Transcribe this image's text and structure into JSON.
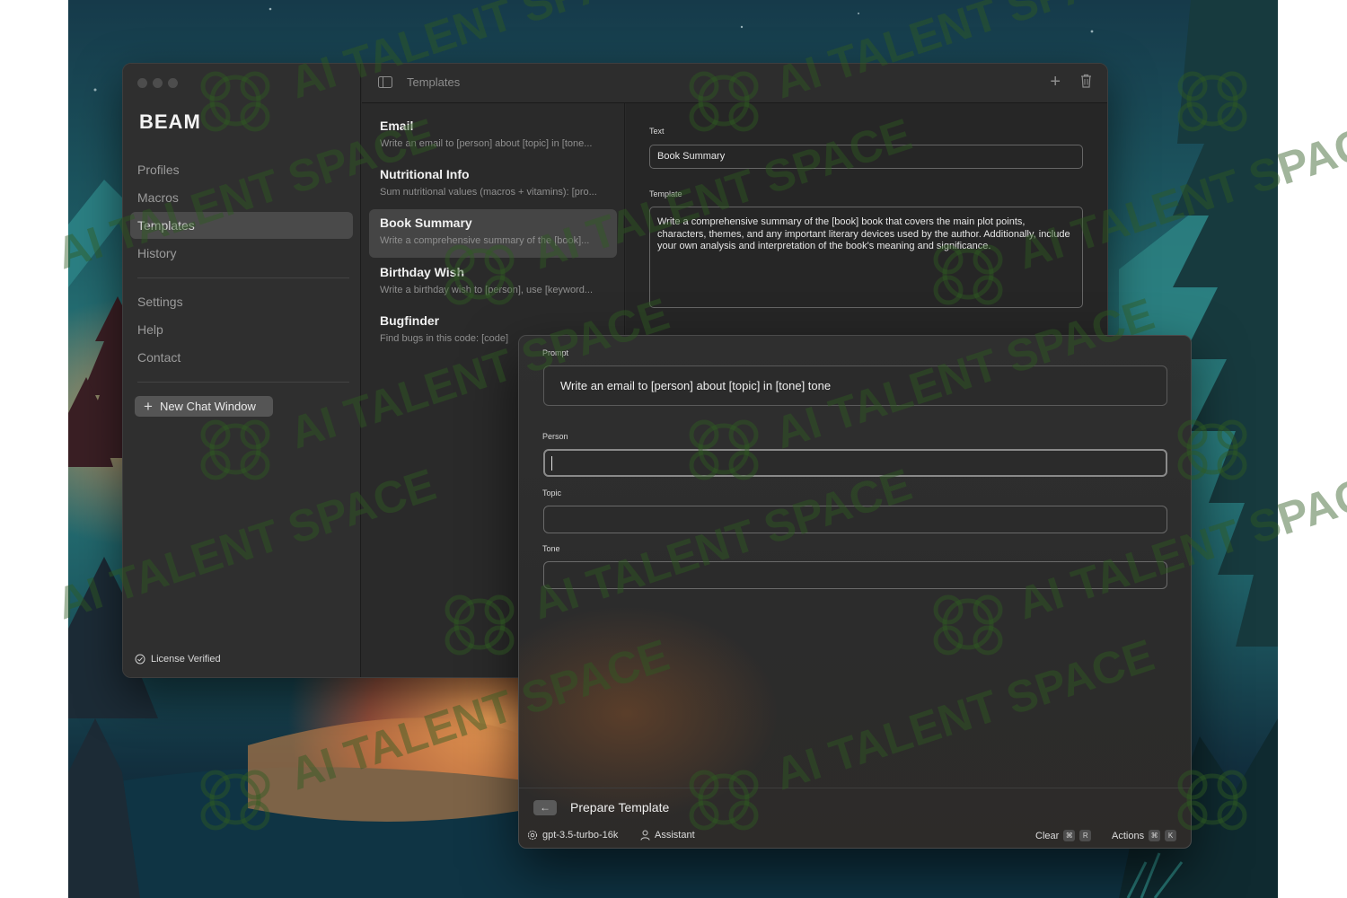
{
  "window": {
    "brand": "BEAM",
    "titlebar_title": "Templates"
  },
  "sidebar": {
    "items": [
      {
        "label": "Profiles"
      },
      {
        "label": "Macros"
      },
      {
        "label": "Templates",
        "active": true
      },
      {
        "label": "History"
      },
      {
        "label": "Settings"
      },
      {
        "label": "Help"
      },
      {
        "label": "Contact"
      }
    ],
    "new_chat_label": "New Chat Window",
    "license_label": "License Verified"
  },
  "templates": [
    {
      "title": "Email",
      "desc": "Write an email to [person] about [topic] in [tone..."
    },
    {
      "title": "Nutritional Info",
      "desc": "Sum nutritional values (macros + vitamins): [pro..."
    },
    {
      "title": "Book Summary",
      "desc": "Write a comprehensive summary of the [book]...",
      "active": true
    },
    {
      "title": "Birthday Wish",
      "desc": "Write a birthday wish to [person], use [keyword..."
    },
    {
      "title": "Bugfinder",
      "desc": "Find bugs in this code: [code]"
    }
  ],
  "detail": {
    "text_label": "Text",
    "text_value": "Book Summary",
    "template_label": "Template",
    "template_value": "Write a comprehensive summary of the [book] book that covers the main plot points, characters, themes, and any important literary devices used by the author. Additionally, include your own analysis and interpretation of the book's meaning and significance."
  },
  "prompt_window": {
    "prompt_label": "Prompt",
    "prompt_value": "Write an email to [person] about [topic] in [tone] tone",
    "fields": [
      {
        "label": "Person",
        "value": ""
      },
      {
        "label": "Topic",
        "value": ""
      },
      {
        "label": "Tone",
        "value": ""
      }
    ],
    "footer_title": "Prepare Template",
    "back_glyph": "←",
    "status": {
      "model": "gpt-3.5-turbo-16k",
      "profile": "Assistant",
      "clear_label": "Clear",
      "clear_keys": [
        "⌘",
        "R"
      ],
      "actions_label": "Actions",
      "actions_keys": [
        "⌘",
        "K"
      ]
    }
  },
  "watermark": {
    "text": "AI TALENT SPACE"
  },
  "colors": {
    "window_bg": "#2a2a2a",
    "sidebar_bg": "#2f2f2f",
    "active_item_bg": "#4a4a4a",
    "watermark": "#2f5a22"
  }
}
